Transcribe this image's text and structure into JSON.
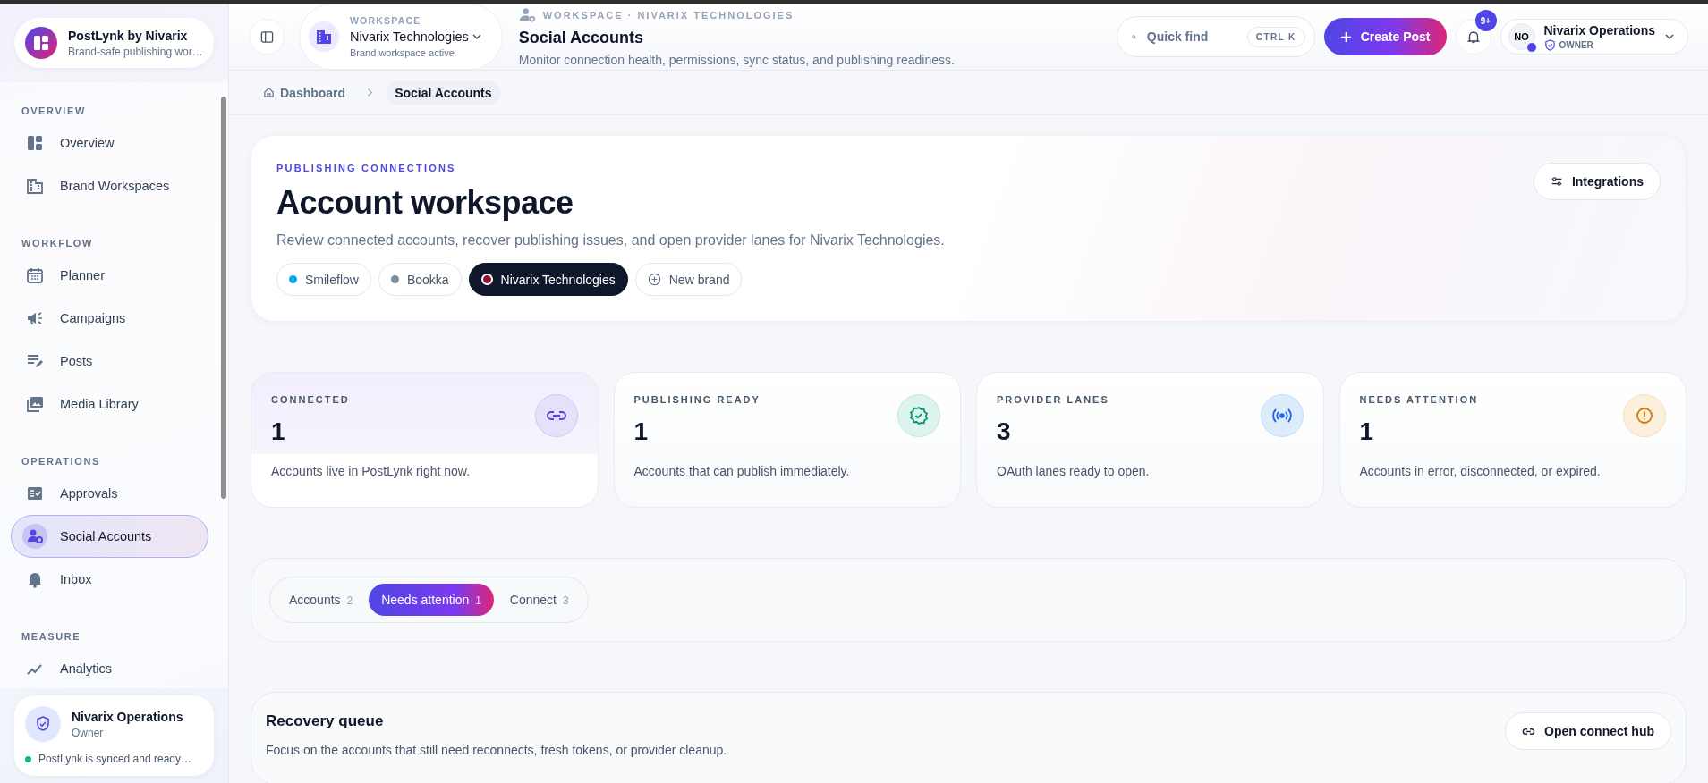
{
  "sidebar": {
    "brand": {
      "name": "PostLynk by Nivarix",
      "tagline": "Brand-safe publishing wor…"
    },
    "sections": [
      {
        "label": "OVERVIEW",
        "items": [
          {
            "label": "Overview",
            "selected": false
          },
          {
            "label": "Brand Workspaces",
            "selected": false
          }
        ]
      },
      {
        "label": "WORKFLOW",
        "items": [
          {
            "label": "Planner",
            "selected": false
          },
          {
            "label": "Campaigns",
            "selected": false
          },
          {
            "label": "Posts",
            "selected": false
          },
          {
            "label": "Media Library",
            "selected": false
          }
        ]
      },
      {
        "label": "OPERATIONS",
        "items": [
          {
            "label": "Approvals",
            "selected": false
          },
          {
            "label": "Social Accounts",
            "selected": true
          },
          {
            "label": "Inbox",
            "selected": false
          }
        ]
      },
      {
        "label": "MEASURE",
        "items": [
          {
            "label": "Analytics",
            "selected": false
          }
        ]
      }
    ],
    "footer": {
      "name": "Nivarix Operations",
      "role": "Owner",
      "status": "PostLynk is synced and ready…",
      "color": "#10b981"
    }
  },
  "header": {
    "workspace": {
      "label": "WORKSPACE",
      "name": "Nivarix Technologies",
      "status": "Brand workspace active"
    },
    "context": "WORKSPACE · NIVARIX TECHNOLOGIES",
    "title": "Social Accounts",
    "subtitle": "Monitor connection health, permissions, sync status, and publishing readiness.",
    "search": {
      "placeholder": "Quick find",
      "shortcut": "CTRL K"
    },
    "create_button": "Create Post",
    "notifications": "9+",
    "user": {
      "initials": "NO",
      "name": "Nivarix Operations",
      "role": "OWNER"
    }
  },
  "breadcrumb": [
    {
      "label": "Dashboard",
      "selected": false
    },
    {
      "label": "Social Accounts",
      "selected": true
    }
  ],
  "hero": {
    "eyebrow": "PUBLISHING CONNECTIONS",
    "title": "Account workspace",
    "description": "Review connected accounts, recover publishing issues, and open provider lanes for Nivarix Technologies.",
    "action": "Integrations",
    "brands": [
      {
        "label": "Smileflow",
        "color": "#0ea5e9",
        "selected": false
      },
      {
        "label": "Bookka",
        "color": "#78909c",
        "selected": false
      },
      {
        "label": "Nivarix Technologies",
        "color": "#8b1538",
        "selected": true
      }
    ],
    "new_brand": "New brand"
  },
  "stats": [
    {
      "label": "CONNECTED",
      "value": "1",
      "description": "Accounts live in PostLynk right now."
    },
    {
      "label": "PUBLISHING READY",
      "value": "1",
      "description": "Accounts that can publish immediately."
    },
    {
      "label": "PROVIDER LANES",
      "value": "3",
      "description": "OAuth lanes ready to open."
    },
    {
      "label": "NEEDS ATTENTION",
      "value": "1",
      "description": "Accounts in error, disconnected, or expired."
    }
  ],
  "tabs": [
    {
      "label": "Accounts",
      "count": "2",
      "selected": false
    },
    {
      "label": "Needs attention",
      "count": "1",
      "selected": true
    },
    {
      "label": "Connect",
      "count": "3",
      "selected": false
    }
  ],
  "recovery": {
    "title": "Recovery queue",
    "description": "Focus on the accounts that still need reconnects, fresh tokens, or provider cleanup.",
    "action": "Open connect hub"
  }
}
